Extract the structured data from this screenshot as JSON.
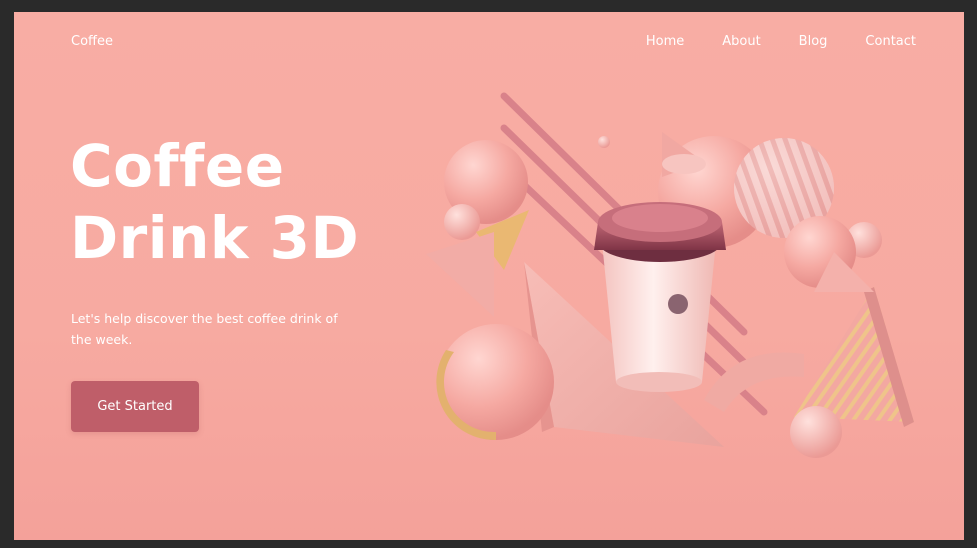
{
  "brand": "Coffee",
  "nav": {
    "links": [
      "Home",
      "About",
      "Blog",
      "Contact"
    ]
  },
  "hero": {
    "title_line1": "Coffee",
    "title_line2": "Drink 3D",
    "subtitle": "Let's help discover the best coffee drink of the week.",
    "cta_label": "Get Started"
  },
  "colors": {
    "background": "#f8ada4",
    "accent": "#bf5e69",
    "cup_lid": "#8e3f4c",
    "gold": "#e3b16e"
  },
  "icons": {
    "illustration": "3d-coffee-cup-illustration"
  }
}
